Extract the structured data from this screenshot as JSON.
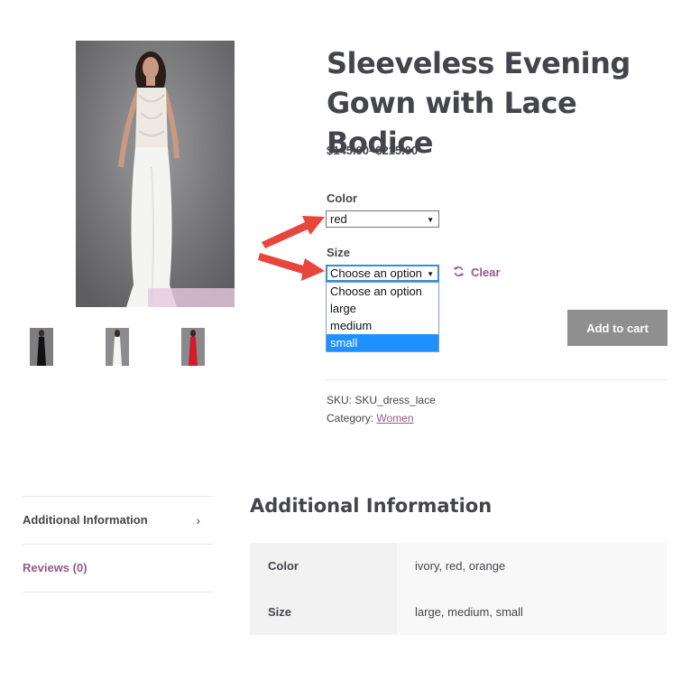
{
  "product": {
    "title": "Sleeveless Evening Gown with Lace Bodice",
    "price": "$145.00–$215.00",
    "sku_label": "SKU:",
    "sku_value": "SKU_dress_lace",
    "category_label": "Category:",
    "category_value": "Women"
  },
  "color_field": {
    "label": "Color",
    "value": "red"
  },
  "size_field": {
    "label": "Size",
    "value": "Choose an option",
    "options": [
      "Choose an option",
      "large",
      "medium",
      "small"
    ],
    "highlighted": "small"
  },
  "actions": {
    "clear_label": "Clear",
    "add_to_cart_label": "Add to cart"
  },
  "tabs": [
    {
      "label": "Additional Information",
      "active": true
    },
    {
      "label": "Reviews (0)",
      "active": false
    }
  ],
  "additional_info": {
    "title": "Additional Information",
    "rows": [
      {
        "name": "Color",
        "value": "ivory, red, orange"
      },
      {
        "name": "Size",
        "value": "large, medium, small"
      }
    ]
  },
  "colors": {
    "accent": "#96588a",
    "text": "#43454b",
    "button_bg": "#8f8f8f",
    "annotation_arrow": "#e8453c",
    "option_highlight": "#1e90ff"
  }
}
